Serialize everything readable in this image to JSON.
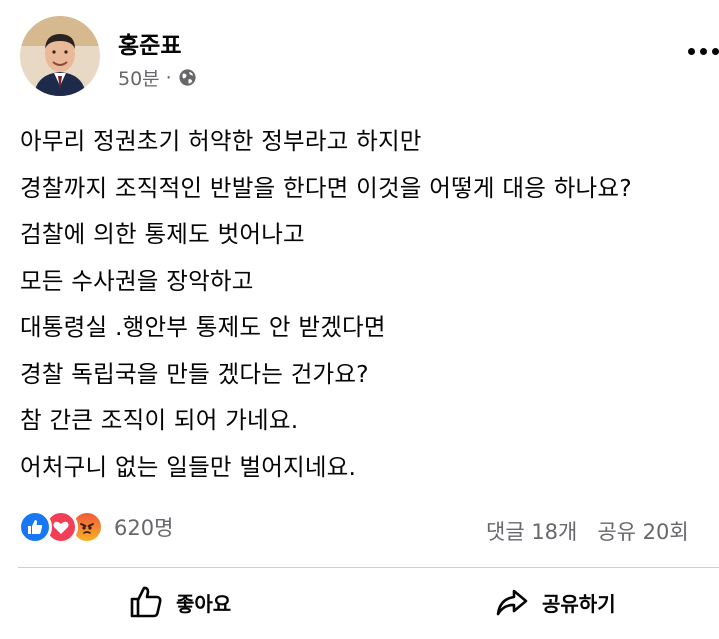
{
  "post": {
    "author": "홍준표",
    "time": "50분",
    "separator": "·",
    "body_lines": [
      "아무리 정권초기 허약한 정부라고 하지만",
      "경찰까지 조직적인 반발을 한다면 이것을 어떻게 대응 하나요?",
      "검찰에 의한 통제도 벗어나고",
      "모든 수사권을 장악하고",
      "대통령실 .행안부 통제도 안 받겠다면",
      "경찰 독립국을 만들 겠다는 건가요?",
      "참 간큰 조직이 되어 가네요.",
      "어처구니 없는 일들만 벌어지네요."
    ]
  },
  "stats": {
    "reactions_count": "620명",
    "comments": "댓글 18개",
    "shares": "공유 20회"
  },
  "actions": {
    "like_label": "좋아요",
    "share_label": "공유하기"
  },
  "icons": {
    "avatar": "profile-photo",
    "audience": "globe-icon",
    "more": "more-options-icon",
    "reactions": [
      "like-reaction-icon",
      "love-reaction-icon",
      "angry-reaction-icon"
    ],
    "like": "thumbs-up-icon",
    "share": "share-arrow-icon"
  },
  "colors": {
    "text": "#050505",
    "secondary_text": "#65676b",
    "like_blue": "#1877f2",
    "love_red": "#f33e58",
    "angry_orange": "#f0593a",
    "divider": "#ced0d4"
  }
}
